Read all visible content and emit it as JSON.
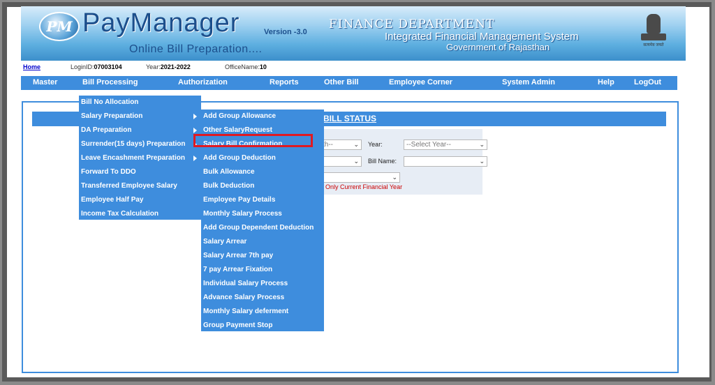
{
  "header": {
    "logo_text": "PM",
    "brand": "PayManager",
    "version": "Version -3.0",
    "subtitle": "Online Bill Preparation....",
    "dept_line1": "FINANCE  DEPARTMENT",
    "dept_line2": "Integrated Financial Management System",
    "dept_line3": "Government of Rajasthan",
    "emblem_motto": "सत्यमेव जयते"
  },
  "infobar": {
    "home": "Home",
    "login_label": "LoginID:",
    "login_value": "07003104",
    "year_label": "Year:",
    "year_value": "2021-2022",
    "office_label": "OfficeName:",
    "office_value": "10"
  },
  "menubar": [
    "Master",
    "Bill Processing",
    "Authorization",
    "Reports",
    "Other Bill",
    "Employee Corner",
    "System Admin",
    "Help",
    "LogOut"
  ],
  "bill_processing_menu": [
    {
      "label": "Bill No Allocation",
      "submenu": false
    },
    {
      "label": "Salary Preparation",
      "submenu": true
    },
    {
      "label": "DA Preparation",
      "submenu": true
    },
    {
      "label": "Surrender(15 days) Preparation",
      "submenu": true
    },
    {
      "label": "Leave Encashment Preparation",
      "submenu": true
    },
    {
      "label": "Forward To DDO",
      "submenu": false
    },
    {
      "label": "Transferred Employee Salary",
      "submenu": false
    },
    {
      "label": "Employee Half Pay",
      "submenu": false
    },
    {
      "label": "Income Tax Calculation",
      "submenu": false
    }
  ],
  "salary_preparation_menu": [
    "Add Group Allowance",
    "Other SalaryRequest",
    "Salary Bill Confirmation",
    "Add Group Deduction",
    "Bulk Allowance",
    "Bulk Deduction",
    "Employee Pay Details",
    "Monthly Salary Process",
    "Add Group Dependent Deduction",
    "Salary Arrear",
    "Salary Arrear 7th pay",
    "7 pay Arrear Fixation",
    "Individual Salary Process",
    "Advance Salary Process",
    "Monthly Salary deferment",
    "Group Payment Stop"
  ],
  "highlighted_item": "Salary Bill Confirmation",
  "content": {
    "title": "BILL STATUS",
    "month_select": "th--",
    "year_label": "Year:",
    "year_select": "--Select Year--",
    "bill_name_label": "Bill Name:",
    "note": "how Only Current Financial Year"
  },
  "colors": {
    "menu_blue": "#3e8ddd",
    "highlight_red": "#e01a22",
    "note_red": "#cc0000"
  }
}
